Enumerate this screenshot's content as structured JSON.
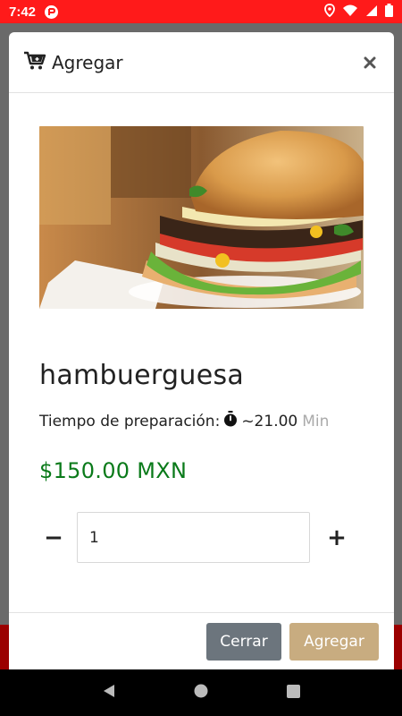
{
  "status_bar": {
    "time": "7:42"
  },
  "modal": {
    "title": "Agregar",
    "product": {
      "name": "hambuerguesa",
      "prep_label": "Tiempo de preparación:",
      "prep_value": "~21.00",
      "prep_unit": "Min",
      "price": "$150.00 MXN"
    },
    "quantity": {
      "value": "1",
      "minus": "−",
      "plus": "+"
    },
    "footer": {
      "cancel_label": "Cerrar",
      "add_label": "Agregar"
    }
  },
  "colors": {
    "status_bar": "#ff1a1a",
    "price": "#0a7a1a",
    "add_button": "#c8ac80",
    "cancel_button": "#6c757d"
  },
  "icons": [
    "cart-plus-icon",
    "close-icon",
    "stopwatch-icon",
    "back-icon",
    "home-icon",
    "recents-icon"
  ]
}
